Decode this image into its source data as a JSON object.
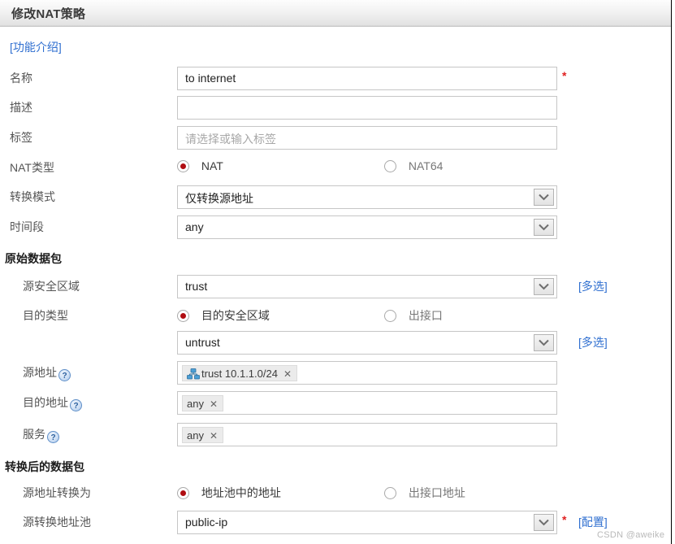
{
  "window": {
    "title": "修改NAT策略"
  },
  "intro": {
    "link_label": "[功能介绍]"
  },
  "form": {
    "name": {
      "label": "名称",
      "value": "to internet",
      "required_marker": "*"
    },
    "description": {
      "label": "描述",
      "value": ""
    },
    "tag": {
      "label": "标签",
      "value": "",
      "placeholder": "请选择或输入标签"
    },
    "nat_type": {
      "label": "NAT类型",
      "options": [
        {
          "label": "NAT",
          "checked": true
        },
        {
          "label": "NAT64",
          "checked": false
        }
      ]
    },
    "translate_mode": {
      "label": "转换模式",
      "value": "仅转换源地址"
    },
    "time_range": {
      "label": "时间段",
      "value": "any"
    }
  },
  "original_packet": {
    "section_title": "原始数据包",
    "source_zone": {
      "label": "源安全区域",
      "value": "trust",
      "side_link": "[多选]"
    },
    "dest_type": {
      "label": "目的类型",
      "options": [
        {
          "label": "目的安全区域",
          "checked": true
        },
        {
          "label": "出接口",
          "checked": false
        }
      ]
    },
    "dest_zone": {
      "value": "untrust",
      "side_link": "[多选]"
    },
    "source_address": {
      "label": "源地址",
      "help_icon": "question-icon",
      "chips": [
        {
          "icon": "network-icon",
          "text": "trust 10.1.1.0/24",
          "remove": "✕"
        }
      ]
    },
    "dest_address": {
      "label": "目的地址",
      "help_icon": "question-icon",
      "chips": [
        {
          "icon": "",
          "text": "any",
          "remove": "✕"
        }
      ]
    },
    "service": {
      "label": "服务",
      "help_icon": "question-icon",
      "chips": [
        {
          "icon": "",
          "text": "any",
          "remove": "✕"
        }
      ]
    }
  },
  "translated_packet": {
    "section_title": "转换后的数据包",
    "source_translate_to": {
      "label": "源地址转换为",
      "options": [
        {
          "label": "地址池中的地址",
          "checked": true
        },
        {
          "label": "出接口地址",
          "checked": false
        }
      ]
    },
    "source_pool": {
      "label": "源转换地址池",
      "value": "public-ip",
      "required_marker": "*",
      "side_link": "[配置]"
    }
  },
  "watermark": {
    "text": "CSDN @aweike"
  },
  "colors": {
    "link": "#2f6fd0",
    "radio_selected": "#b00d12",
    "required": "#e02020",
    "titlebar_text": "#3b3b3b",
    "label_text": "#555555",
    "chip_bg": "#ebebeb"
  }
}
